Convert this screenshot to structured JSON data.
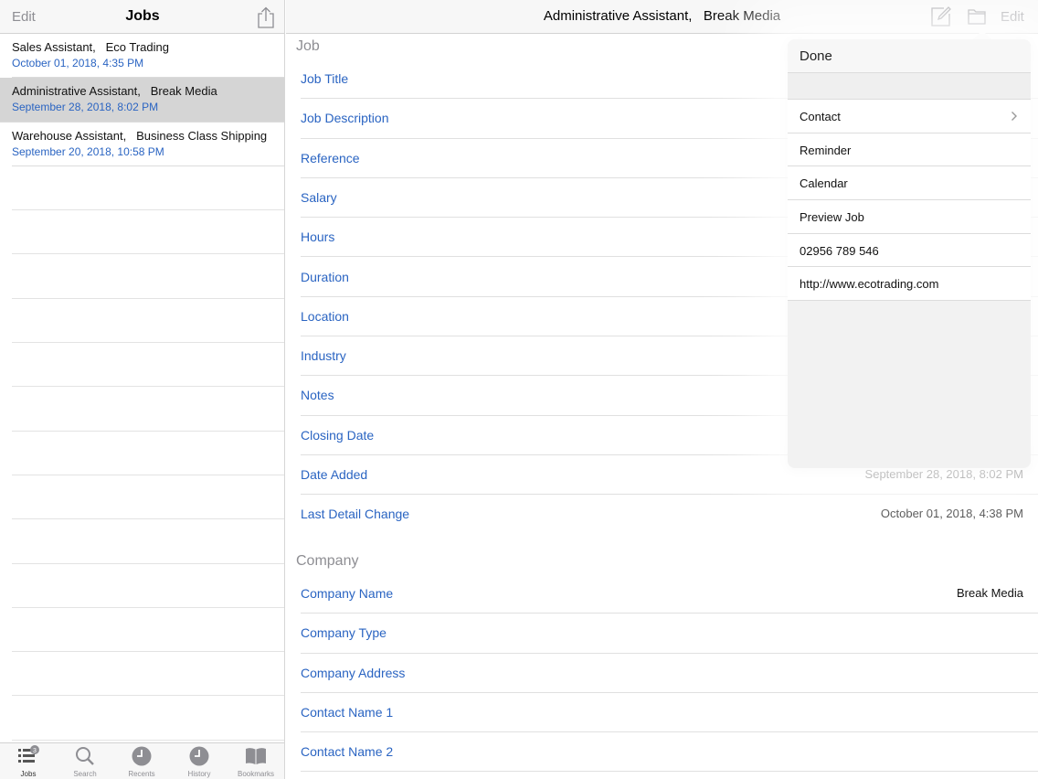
{
  "sidebar": {
    "edit_label": "Edit",
    "title": "Jobs",
    "share_icon": "share-icon",
    "jobs": [
      {
        "title": "Sales Assistant,   Eco Trading",
        "date": "October 01, 2018, 4:35 PM",
        "selected": false
      },
      {
        "title": "Administrative Assistant,   Break Media",
        "date": "September 28, 2018, 8:02 PM",
        "selected": true
      },
      {
        "title": "Warehouse Assistant,   Business Class Shipping",
        "date": "September 20, 2018, 10:58 PM",
        "selected": false
      }
    ],
    "tabs": [
      {
        "label": "Jobs",
        "icon": "jobs-list-icon",
        "badge": "3",
        "active": true
      },
      {
        "label": "Search",
        "icon": "search-icon",
        "active": false
      },
      {
        "label": "Recents",
        "icon": "clock-icon",
        "active": false
      },
      {
        "label": "History",
        "icon": "clock-icon",
        "active": false
      },
      {
        "label": "Bookmarks",
        "icon": "book-icon",
        "active": false
      }
    ]
  },
  "detail": {
    "title": "Administrative Assistant,   Break Media",
    "edit_label": "Edit",
    "compose_icon": "compose-icon",
    "folder_icon": "folder-icon",
    "job_section": {
      "header": "Job",
      "fields": [
        {
          "label": "Job Title",
          "value": ""
        },
        {
          "label": "Job Description",
          "value": ""
        },
        {
          "label": "Reference",
          "value": ""
        },
        {
          "label": "Salary",
          "value": ""
        },
        {
          "label": "Hours",
          "value": ""
        },
        {
          "label": "Duration",
          "value": ""
        },
        {
          "label": "Location",
          "value": ""
        },
        {
          "label": "Industry",
          "value": ""
        },
        {
          "label": "Notes",
          "value": ""
        },
        {
          "label": "Closing Date",
          "value": ""
        },
        {
          "label": "Date Added",
          "value": "September 28, 2018, 8:02 PM"
        },
        {
          "label": "Last Detail Change",
          "value": "October 01, 2018, 4:38 PM"
        }
      ]
    },
    "company_section": {
      "header": "Company",
      "fields": [
        {
          "label": "Company Name",
          "value": "Break Media"
        },
        {
          "label": "Company Type",
          "value": ""
        },
        {
          "label": "Company Address",
          "value": ""
        },
        {
          "label": "Contact Name 1",
          "value": ""
        },
        {
          "label": "Contact Name 2",
          "value": ""
        }
      ]
    }
  },
  "popover": {
    "done_label": "Done",
    "items": [
      {
        "label": "Contact",
        "has_chevron": true
      },
      {
        "label": "Reminder",
        "has_chevron": false
      },
      {
        "label": "Calendar",
        "has_chevron": false
      },
      {
        "label": "Preview Job",
        "has_chevron": false
      },
      {
        "label": "02956 789 546",
        "has_chevron": false
      },
      {
        "label": "http://www.ecotrading.com",
        "has_chevron": false
      }
    ]
  },
  "colors": {
    "accent": "#2a64c2",
    "muted": "#8e8e93",
    "selected_row": "#d5d5d5"
  }
}
